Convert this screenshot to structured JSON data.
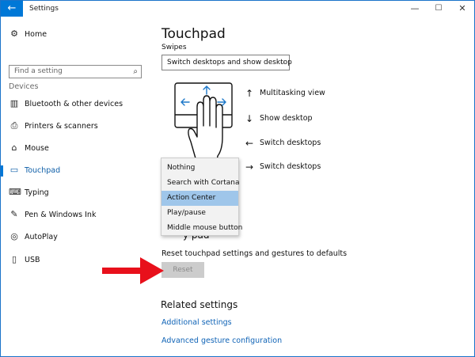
{
  "titlebar": {
    "title": "Settings",
    "back_glyph": "←",
    "minimize_glyph": "—",
    "maximize_glyph": "☐",
    "close_glyph": "✕"
  },
  "sidebar": {
    "home_label": "Home",
    "home_icon": "gear-icon",
    "search_placeholder": "Find a setting",
    "search_icon": "search-icon",
    "section_label": "Devices",
    "items": [
      {
        "label": "Bluetooth & other devices",
        "icon": "bluetooth-devices-icon",
        "glyph": "▥"
      },
      {
        "label": "Printers & scanners",
        "icon": "printer-icon",
        "glyph": "⎙"
      },
      {
        "label": "Mouse",
        "icon": "mouse-icon",
        "glyph": "⌂"
      },
      {
        "label": "Touchpad",
        "icon": "touchpad-icon",
        "glyph": "▭",
        "active": true
      },
      {
        "label": "Typing",
        "icon": "keyboard-icon",
        "glyph": "⌨"
      },
      {
        "label": "Pen & Windows Ink",
        "icon": "pen-icon",
        "glyph": "✎"
      },
      {
        "label": "AutoPlay",
        "icon": "autoplay-icon",
        "glyph": "◎"
      },
      {
        "label": "USB",
        "icon": "usb-icon",
        "glyph": "▯"
      }
    ]
  },
  "main": {
    "title": "Touchpad",
    "swipes_label": "Swipes",
    "swipes_value": "Switch desktops and show desktop",
    "gestures": [
      {
        "arrow": "↑",
        "label": "Multitasking view"
      },
      {
        "arrow": "↓",
        "label": "Show desktop"
      },
      {
        "arrow": "←",
        "label": "Switch desktops"
      },
      {
        "arrow": "→",
        "label": "Switch desktops"
      }
    ],
    "dropdown_options": [
      {
        "label": "Nothing"
      },
      {
        "label": "Search with Cortana"
      },
      {
        "label": "Action Center",
        "highlighted": true
      },
      {
        "label": "Play/pause"
      },
      {
        "label": "Middle mouse button"
      }
    ],
    "reset_heading_partial": "y                    pad",
    "reset_description": "Reset touchpad settings and gestures to defaults",
    "reset_button": "Reset",
    "related_heading": "Related settings",
    "links": [
      {
        "label": "Additional settings"
      },
      {
        "label": "Advanced gesture configuration"
      }
    ]
  },
  "colors": {
    "accent": "#0078d7",
    "link": "#0f63b6",
    "highlight": "#9fc6ea",
    "annotation_arrow": "#e8101b"
  }
}
